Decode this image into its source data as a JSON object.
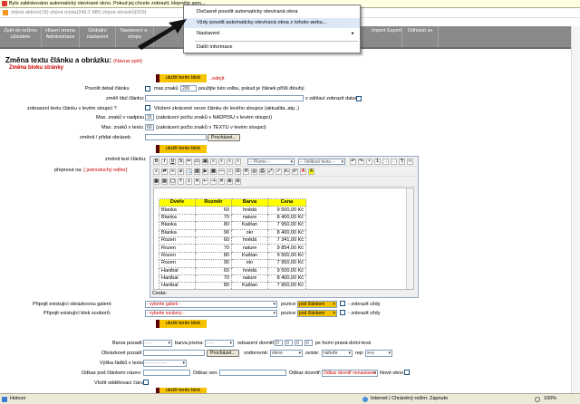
{
  "infobar": {
    "text": "Bylo zablokováno automatický otevírané okno. Pokud jej chcete zobrazit, klepněte sem..."
  },
  "statusline": {
    "text": "zbývá aktivní(18)  zbývá místa(249.2 MB)  zbývá obrázků(209)"
  },
  "nav": [
    {
      "label": "Zpět do režimu uživatele"
    },
    {
      "label": "Hlavní strana Administrace"
    },
    {
      "label": "Globální nastavení"
    },
    {
      "label": "Nastavení e-shopu"
    },
    {
      "label": ""
    },
    {
      "label": ""
    },
    {
      "label": "Import Export"
    },
    {
      "label": "Odhlásit se"
    }
  ],
  "menu": {
    "item1": "Dočasně povolit automaticky otevíraná okna",
    "item2": "Vždy povolit automaticky otevíraná okna z tohoto webu...",
    "item3": "Nastavení",
    "item4": "Další informace"
  },
  "page": {
    "title": "Změna textu článku a obrázku:",
    "back": "(Návrat zpět)",
    "subtitle": "Změna bloku stránky",
    "save": "uložit tento blok",
    "leave": "..odejít"
  },
  "form": {
    "detail_label": "Povolit detail článku",
    "max_znaku": "max.znaků",
    "max_znaku_value": "200",
    "detail_note": "použijte tuto volbu, pokud je článek příliš dlouhý.",
    "title_label": "změň titul článku:",
    "title_value": "",
    "title_note": "v záhlaví zobrazit datum",
    "show_text_label": "zobrazení textu článku v levém sloupci ?",
    "show_text_note": "Vložení zkrácené verze článku do levého sloupce (aktualita..atp..)",
    "max_title_label": "Max. znaků v nadpisu",
    "max_title_value": "15",
    "max_title_note": "(zakrácení počtu znaků v NADPISU v levém sloupci)",
    "max_text_label": "Max. znaků v textu",
    "max_text_value": "60",
    "max_text_note": "(zakrácení počtu znaků v TEXTU v levém sloupci)",
    "image_label": "změnit / přidat obrázek:",
    "browse": "Procházet...",
    "edit_text_label": "změnit text článku:",
    "switch_label": "přepnout na:",
    "switch_link": "[ jednoduchý editor]",
    "font_sel": "-- Písmo --",
    "size_sel": "-- Velikost textu --",
    "path": "Cesta:",
    "attach_gallery_label": "Připojit existující obrázkovou galerii:",
    "attach_gallery_sel": "- vyberte galerii -",
    "pozice": "pozice:",
    "pod_clankem": "pod článkem",
    "zobrazit_vzdy": "- zobrazit vždy",
    "attach_files_label": "Připojit existující blok souborů:",
    "attach_files_sel": "- vyberte soubory -",
    "bg_color_label": "Barva pozadí:",
    "font_color_label": "barva písma:",
    "dash": "- - -",
    "odsazeni": "odsazení dovnitř:",
    "odsazeni_vals": [
      "0",
      "0",
      "0",
      "0"
    ],
    "odsazeni_note": "px horní-pravá-dolní-levá",
    "bg_image_label": "Obrázkové pozadí",
    "vodorovne": "vodorovně:",
    "vodorovne_sel": "vlevo",
    "svisle": "svisle:",
    "svisle_sel": "nahoře",
    "rep": "rep:",
    "rep_sel": "x+y",
    "row_height_label": "Výška řádků v textu:",
    "row_height_sel": "- - - - - - - -",
    "link_name_label": "Odkaz pod článkem název:",
    "link_url_label": "Odkaz ven:",
    "link_inside_label": "Odkaz dovnitř:",
    "link_inside_sel": "Odkaz dovnitř nenastaven",
    "new_window": "Nové okno",
    "divider_label": "Vložit oddělovací čáru:"
  },
  "table": {
    "headers": [
      "Dveře",
      "Rozměr",
      "Barva",
      "Cena"
    ],
    "rows": [
      [
        "Blanka",
        "60",
        "hnědá",
        "9 500,00 Kč"
      ],
      [
        "Blanka",
        "70",
        "nature",
        "8 400,00 Kč"
      ],
      [
        "Blanka",
        "80",
        "Kaštan",
        "7 950,00 Kč"
      ],
      [
        "Blanka",
        "90",
        "okr",
        "8 400,00 Kč"
      ],
      [
        "Rozen",
        "60",
        "hnědá",
        "7 341,00 Kč"
      ],
      [
        "Rozen",
        "70",
        "nature",
        "9 854,00 Kč"
      ],
      [
        "Rozen",
        "80",
        "Kaštan",
        "9 500,00 Kč"
      ],
      [
        "Rozen",
        "90",
        "okr",
        "7 950,00 Kč"
      ],
      [
        "Hanibal",
        "60",
        "hnědá",
        "9 500,00 Kč"
      ],
      [
        "Hanibal",
        "70",
        "nature",
        "8 400,00 Kč"
      ],
      [
        "Hanibal",
        "80",
        "Kaštan",
        "7 950,00 Kč"
      ],
      [
        "Hanibal",
        "90",
        "okr",
        "8 400,00 Kč"
      ]
    ]
  },
  "statusbar": {
    "left": "Hotovo",
    "zone": "Internet | Chráněný režim: Zapnuto",
    "zoom": "100%"
  }
}
